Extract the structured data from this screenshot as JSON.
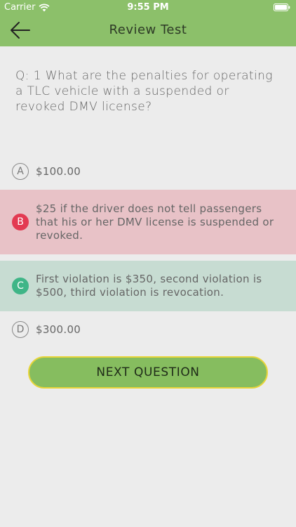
{
  "status_bar": {
    "carrier": "Carrier",
    "time": "9:55 PM"
  },
  "nav": {
    "title": "Review Test"
  },
  "question": {
    "text": "Q: 1 What are the penalties for operating a TLC vehicle with a suspended or revoked DMV license?"
  },
  "options": [
    {
      "letter": "A",
      "text": "$100.00",
      "state": "default"
    },
    {
      "letter": "B",
      "text": "$25 if the driver does not tell passengers that his or her DMV license is suspended or revoked.",
      "state": "wrong"
    },
    {
      "letter": "C",
      "text": "First violation is $350, second violation is $500, third violation is revocation.",
      "state": "correct"
    },
    {
      "letter": "D",
      "text": "$300.00",
      "state": "default"
    }
  ],
  "next_button": {
    "label": "NEXT QUESTION"
  },
  "colors": {
    "header": "#8cc06a",
    "wrong": "#e33a52",
    "wrong_bg": "#e8c2c7",
    "correct": "#3fb587",
    "correct_bg": "#c7dcd2",
    "button_border": "#e8d53a"
  }
}
